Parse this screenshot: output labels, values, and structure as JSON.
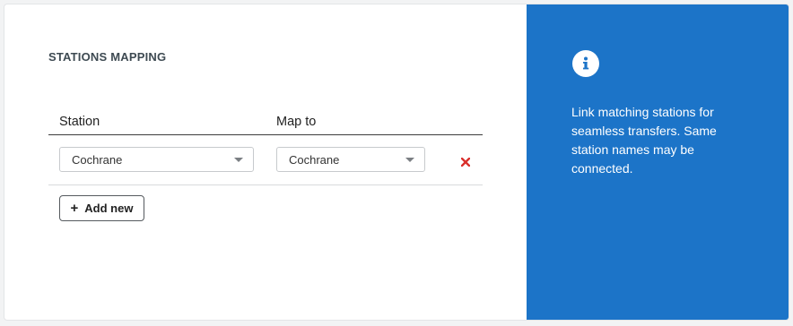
{
  "section": {
    "title": "STATIONS MAPPING"
  },
  "table": {
    "columns": [
      "Station",
      "Map to"
    ],
    "rows": [
      {
        "station": "Cochrane",
        "map_to": "Cochrane"
      }
    ]
  },
  "actions": {
    "add_label": "Add new"
  },
  "info_panel": {
    "text": "Link matching stations for seamless transfers. Same station names may be connected.",
    "background": "#1c74c8"
  },
  "icons": {
    "info": "info-circle-icon",
    "remove": "close-x-icon",
    "add": "plus-icon",
    "dropdown": "caret-down-icon"
  },
  "colors": {
    "remove_icon": "#d9302c"
  }
}
